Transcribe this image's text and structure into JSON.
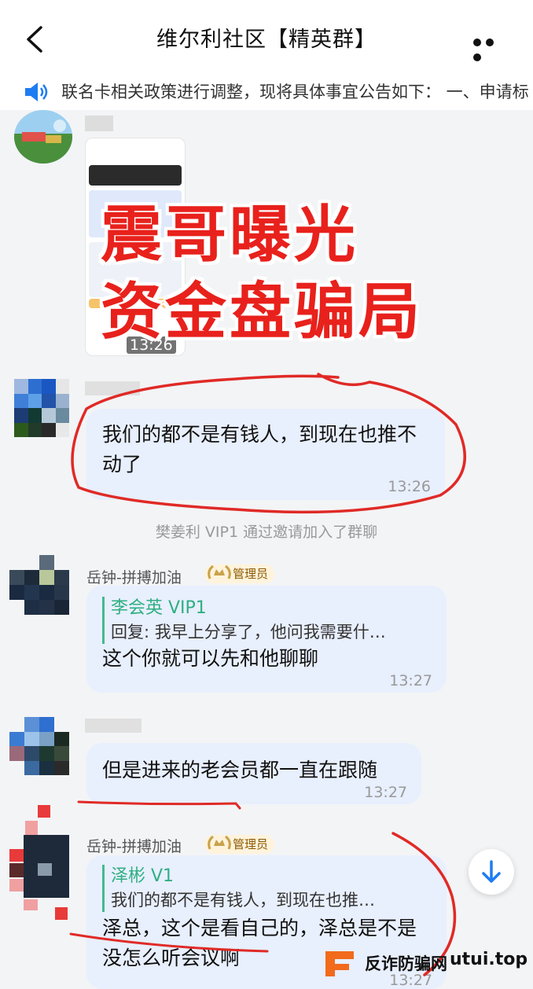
{
  "header": {
    "title": "维尔利社区【精英群】"
  },
  "notice": {
    "text": "联名卡相关政策进行调整，现将具体事宜公告如下： 一、申请标"
  },
  "messages": {
    "m1": {
      "time": "13:26"
    },
    "m2": {
      "text": "我们的都不是有钱人，到现在也推不动了",
      "time": "13:26"
    },
    "system": "樊姜利 VIP1 通过邀请加入了群聊",
    "m3": {
      "sender": "岳钟-拼搏加油",
      "badge": "管理员",
      "quote_name": "李会英 VIP1",
      "quote_text": "回复: 我早上分享了，他问我需要什…",
      "text": "这个你就可以先和他聊聊",
      "time": "13:27"
    },
    "m4": {
      "text": "但是进来的老会员都一直在跟随",
      "time": "13:27"
    },
    "m5": {
      "sender": "岳钟-拼搏加油",
      "badge": "管理员",
      "quote_name": "泽彬 V1",
      "quote_text": "我们的都不是有钱人，到现在也推…",
      "text": "泽总，这个是看自己的，泽总是不是没怎么听会议啊",
      "time": "13:27"
    }
  },
  "overlay": {
    "line1": "震哥曝光",
    "line2": "资金盘骗局"
  },
  "watermark": {
    "site": "反诈防骗网",
    "domain": "utui.top"
  },
  "colors": {
    "bubble": "#e8effd",
    "accent_red": "#e8211c",
    "quote_green": "#2eaf82"
  }
}
